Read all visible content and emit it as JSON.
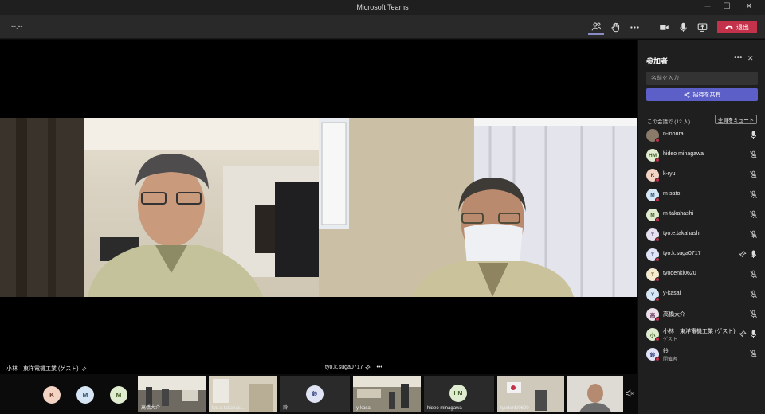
{
  "window": {
    "title": "Microsoft Teams"
  },
  "toolbar": {
    "timer": "--:--",
    "leave_label": "退出"
  },
  "stage": {
    "videos": [
      {
        "label": "小林　東洋電機工業 (ゲスト)"
      },
      {
        "label": "tyo.k.suga0717",
        "more": "•••"
      }
    ]
  },
  "filmstrip": {
    "avatars": [
      {
        "initial": "K",
        "color": "#f3d4c4",
        "fg": "#6b3d2a"
      },
      {
        "initial": "M",
        "color": "#d6e6f5",
        "fg": "#2a4d6b"
      },
      {
        "initial": "M",
        "color": "#dfeccf",
        "fg": "#3e5a24"
      }
    ],
    "labels": {
      "takahashi": "高橋大介",
      "tyo_e": "tyo.e.takahas...",
      "suzu": "鈴",
      "y_kasai": "y-kasai",
      "hideo": "hideo minagawa",
      "tyodenki": "tyodenki0620"
    },
    "hm_initial": "HM"
  },
  "panel": {
    "title": "参加者",
    "search_placeholder": "名前を入力",
    "share_label": "招待を共有",
    "meeting_count": "この会議で (12 人)",
    "mute_all_label": "全員をミュート",
    "participants": [
      {
        "name": "n-inoura",
        "initial": "",
        "avatar": "#8a7a6a",
        "fg": "#fff",
        "mic": "on",
        "status": "#c4314b"
      },
      {
        "name": "hideo minagawa",
        "initial": "HM",
        "avatar": "#dfeccf",
        "fg": "#3e5a24",
        "mic": "off",
        "status": "#c4314b"
      },
      {
        "name": "k-ryu",
        "initial": "K",
        "avatar": "#f3d4c4",
        "fg": "#6b3d2a",
        "mic": "off",
        "status": "#c4314b"
      },
      {
        "name": "m-sato",
        "initial": "M",
        "avatar": "#d6e6f5",
        "fg": "#2a4d6b",
        "mic": "off",
        "status": "#c4314b"
      },
      {
        "name": "m-takahashi",
        "initial": "M",
        "avatar": "#dfeccf",
        "fg": "#3e5a24",
        "mic": "off",
        "status": "#c4314b"
      },
      {
        "name": "tyo.e.takahashi",
        "initial": "T",
        "avatar": "#e7e0f0",
        "fg": "#4a3a6b",
        "mic": "off",
        "status": "#c4314b"
      },
      {
        "name": "tyo.k.suga0717",
        "initial": "T",
        "avatar": "#e0e4f5",
        "fg": "#33407a",
        "mic": "on",
        "pin": true,
        "status": "#c4314b"
      },
      {
        "name": "tyodenki0620",
        "initial": "T",
        "avatar": "#f5ecd0",
        "fg": "#6b5420",
        "mic": "off",
        "status": "#c4314b"
      },
      {
        "name": "y-kasai",
        "initial": "Y",
        "avatar": "#d6e6f5",
        "fg": "#2a4d6b",
        "mic": "off",
        "status": "#c4314b"
      },
      {
        "name": "高橋大介",
        "initial": "高",
        "avatar": "#ece0ea",
        "fg": "#6b3a5e",
        "mic": "off",
        "status": "#c4314b"
      },
      {
        "name": "小林　東洋電機工業 (ゲスト)",
        "sub": "ゲスト",
        "initial": "小",
        "avatar": "#dfeccf",
        "fg": "#3e5a24",
        "mic": "on",
        "pin": true,
        "status": "#c4314b"
      },
      {
        "name": "鈴",
        "sub": "開催者",
        "initial": "鈴",
        "avatar": "#e0e4f5",
        "fg": "#33407a",
        "mic": "off",
        "status": "#c4314b"
      }
    ]
  }
}
